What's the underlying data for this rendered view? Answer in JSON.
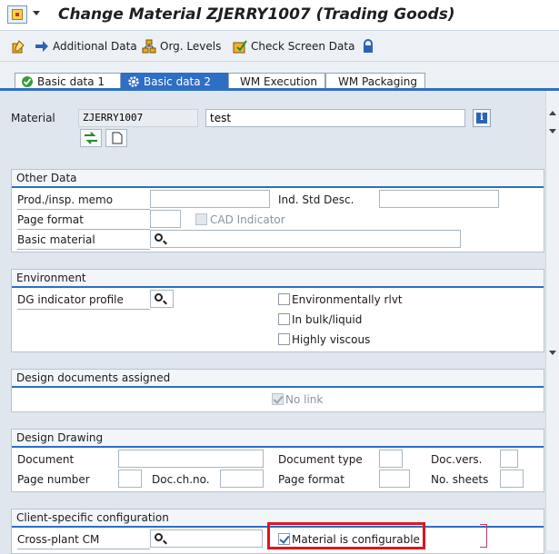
{
  "title": "Change Material ZJERRY1007 (Trading Goods)",
  "toolbar": {
    "additional_data": "Additional Data",
    "org_levels": "Org. Levels",
    "check_screen_data": "Check Screen Data"
  },
  "tabs": [
    {
      "label": "Basic data 1",
      "active": false
    },
    {
      "label": "Basic data 2",
      "active": true
    },
    {
      "label": "WM Execution",
      "active": false
    },
    {
      "label": "WM Packaging",
      "active": false
    }
  ],
  "material": {
    "label": "Material",
    "number": "ZJERRY1007",
    "description": "test"
  },
  "other_data": {
    "title": "Other Data",
    "prod_insp_memo_label": "Prod./insp. memo",
    "prod_insp_memo_value": "",
    "ind_std_desc_label": "Ind. Std Desc.",
    "ind_std_desc_value": "",
    "page_format_label": "Page format",
    "page_format_value": "",
    "cad_indicator_label": "CAD Indicator",
    "cad_indicator_checked": false,
    "basic_material_label": "Basic material",
    "basic_material_value": ""
  },
  "environment": {
    "title": "Environment",
    "dg_indicator_profile_label": "DG indicator profile",
    "dg_indicator_profile_value": "",
    "env_relevant_label": "Environmentally rlvt",
    "in_bulk_label": "In bulk/liquid",
    "highly_viscous_label": "Highly viscous"
  },
  "design_docs": {
    "title": "Design documents assigned",
    "no_link_label": "No link",
    "no_link_checked": true
  },
  "design_drawing": {
    "title": "Design Drawing",
    "document_label": "Document",
    "document_type_label": "Document type",
    "doc_vers_label": "Doc.vers.",
    "page_number_label": "Page number",
    "doc_ch_no_label": "Doc.ch.no.",
    "page_format_label": "Page format",
    "no_sheets_label": "No. sheets"
  },
  "client_config": {
    "title": "Client-specific configuration",
    "cross_plant_cm_label": "Cross-plant CM",
    "cross_plant_cm_value": "",
    "material_configurable_label": "Material is configurable",
    "material_configurable_checked": true
  },
  "colors": {
    "accent": "#2e6ec5",
    "highlight_box": "#e0141e"
  }
}
